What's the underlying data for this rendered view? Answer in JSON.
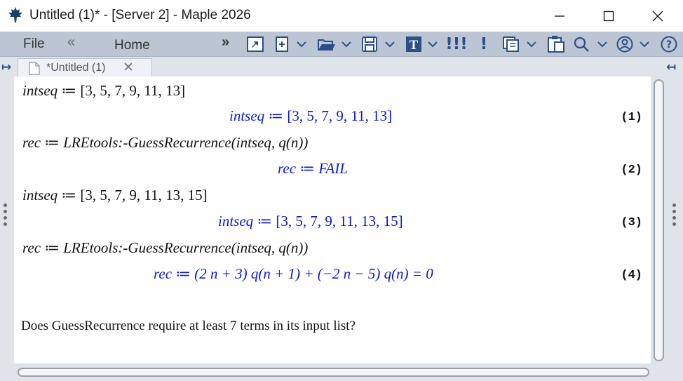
{
  "window": {
    "title": "Untitled (1)* - [Server 2] - Maple 2026",
    "minimize_glyph": "—",
    "maximize_glyph": "☐",
    "close_glyph": "✕"
  },
  "toolbar": {
    "file_label": "File",
    "collapse_glyph": "«",
    "home_label": "Home",
    "more_glyph": "»",
    "icons": [
      "pin-icon",
      "new-document-icon",
      "open-folder-icon",
      "save-icon",
      "text-mode-icon",
      "execute-all-icon",
      "execute-icon",
      "copy-icon",
      "paste-icon",
      "search-icon",
      "account-icon",
      "help-icon"
    ],
    "text_mode_letter": "T",
    "execute_all_glyph": "!!!",
    "execute_glyph": "!",
    "help_glyph": "?",
    "accent_color": "#2c4f8a"
  },
  "tabs": {
    "active_label": "*Untitled (1)",
    "close_glyph": "✕",
    "left_arrow": "↦",
    "right_arrow": "↤"
  },
  "worksheet": {
    "input1": {
      "lhs": "intseq",
      "op": "≔",
      "rhs": "[3, 5, 7, 9, 11, 13]"
    },
    "output1": {
      "lhs": "intseq",
      "op": "≔",
      "rhs": "[3, 5, 7, 9, 11, 13]",
      "label": "(1)"
    },
    "input2": {
      "lhs": "rec",
      "op": "≔",
      "rhs": "LREtools:-GuessRecurrence(intseq, q(n))"
    },
    "output2": {
      "lhs": "rec",
      "op": "≔",
      "rhs": "FAIL",
      "label": "(2)"
    },
    "input3": {
      "lhs": "intseq",
      "op": "≔",
      "rhs": "[3, 5, 7, 9, 11, 13, 15]"
    },
    "output3": {
      "lhs": "intseq",
      "op": "≔",
      "rhs": "[3, 5, 7, 9, 11, 13, 15]",
      "label": "(3)"
    },
    "input4": {
      "lhs": "rec",
      "op": "≔",
      "rhs": "LREtools:-GuessRecurrence(intseq, q(n))"
    },
    "output4": {
      "lhs": "rec",
      "op": "≔",
      "rhs": "(2 n + 3) q(n + 1) + (−2 n − 5) q(n) = 0",
      "label": "(4)"
    },
    "question": "Does GuessRecurrence require at least 7 terms in its input list?",
    "output_color": "#0a18d6"
  }
}
